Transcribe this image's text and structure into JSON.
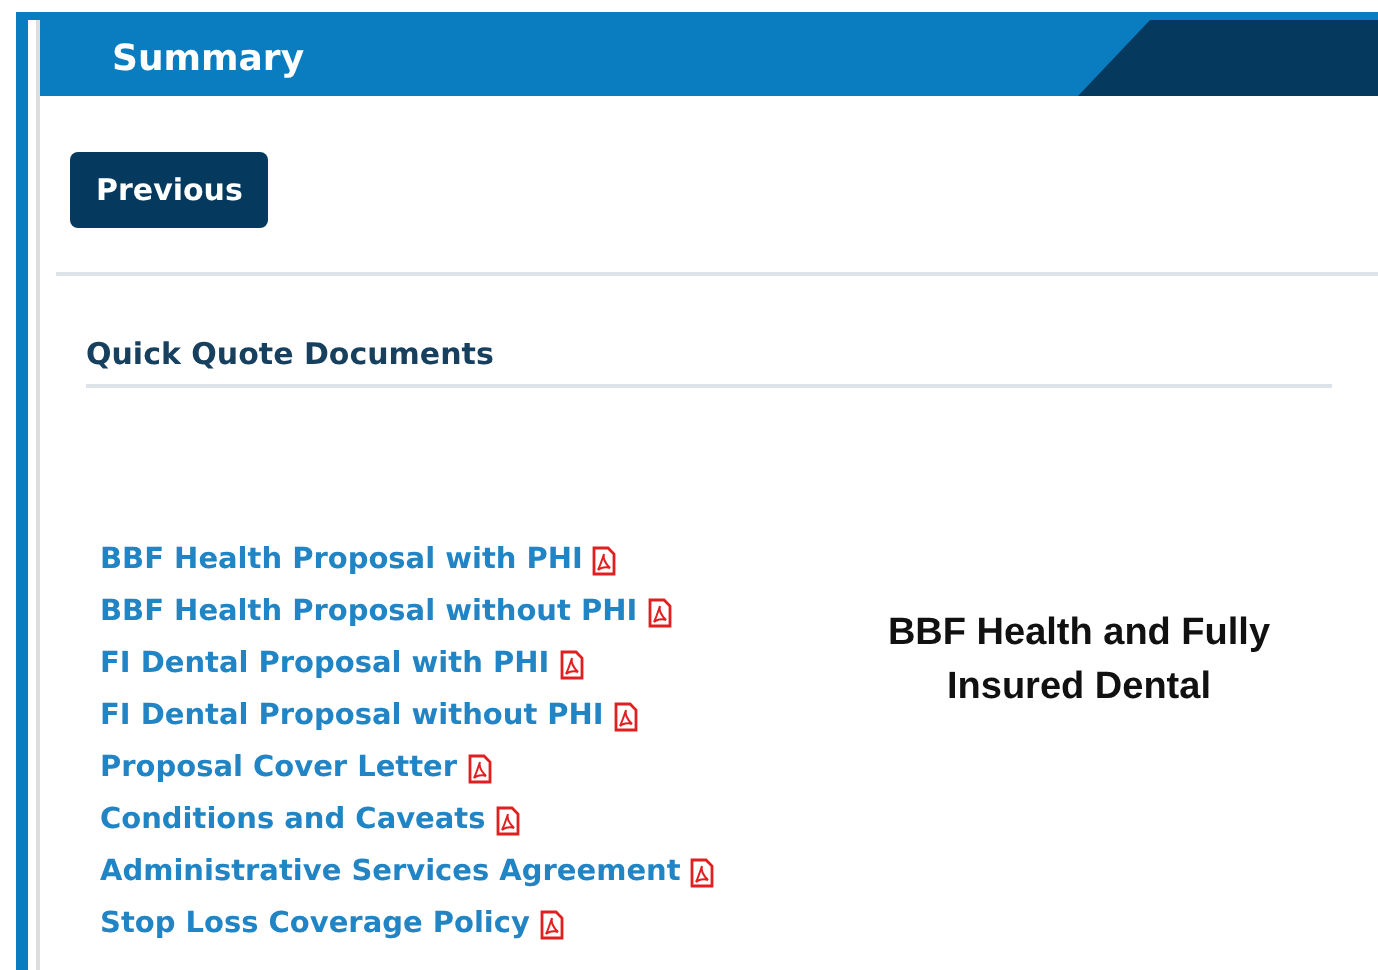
{
  "header": {
    "title": "Summary"
  },
  "buttons": [
    "Previous"
  ],
  "section": {
    "title": "Quick Quote Documents"
  },
  "documents": [
    {
      "label": "BBF Health Proposal with PHI"
    },
    {
      "label": "BBF Health Proposal without PHI"
    },
    {
      "label": "FI Dental Proposal with PHI"
    },
    {
      "label": "FI Dental Proposal without PHI"
    },
    {
      "label": "Proposal Cover Letter"
    },
    {
      "label": "Conditions and Caveats"
    },
    {
      "label": "Administrative Services Agreement"
    },
    {
      "label": "Stop Loss Coverage Policy"
    }
  ],
  "caption": "BBF Health and Fully Insured Dental"
}
